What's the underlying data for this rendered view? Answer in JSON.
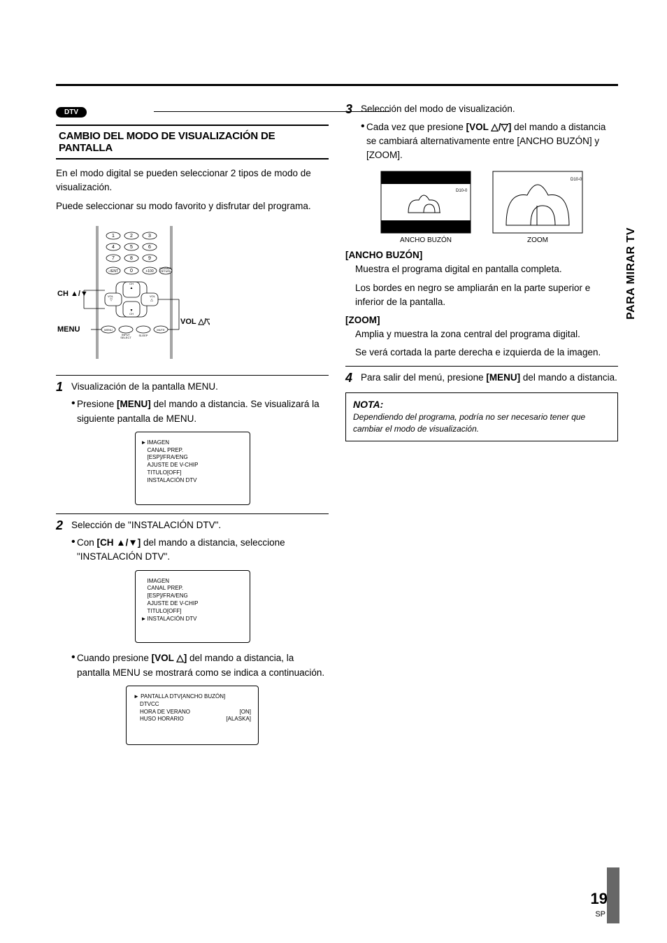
{
  "dtv_label": "DTV",
  "side_tab": "PARA MIRAR TV",
  "page_number": "19",
  "page_sp": "SP",
  "section_title": "CAMBIO DEL MODO DE VISUALIZACIÓN DE PANTALLA",
  "intro1": "En el modo digital se pueden seleccionar 2 tipos de modo de visualización.",
  "intro2": "Puede seleccionar su modo favorito y disfrutar del programa.",
  "remote_labels": {
    "ch": "CH ▲/▼",
    "menu": "MENU",
    "vol": "VOL △/▽"
  },
  "remote_btns": {
    "ent": "–/ENT",
    "plus100": "+100",
    "chret": "CHANNEL\nRETURN",
    "ch_up": "CH",
    "ch_dn": "CH",
    "vol_l": "VOL",
    "vol_r": "VOL",
    "menu": "MENU",
    "input": "INPUT\nSELECT",
    "sleep": "SLEEP",
    "mute": "MUTE"
  },
  "step1": {
    "title": "Visualización de la pantalla MENU.",
    "bullet_a": "Presione ",
    "bullet_a_bold": "[MENU]",
    "bullet_a2": " del mando a distancia. Se visualizará la siguiente pantalla de MENU."
  },
  "menu_items": [
    "IMAGEN",
    "CANAL PREP.",
    "[ESP]/FRA/ENG",
    "AJUSTE DE V-CHIP",
    "TITULO[OFF]",
    "INSTALACIÓN DTV"
  ],
  "step2": {
    "title_a": "Selección de \"INSTALACIÓN DTV\".",
    "bullet_pre": "Con ",
    "bullet_bold": "[CH ▲/▼]",
    "bullet_post": " del mando a distancia, seleccione \"INSTALACIÓN DTV\".",
    "bullet2_pre": "Cuando presione ",
    "bullet2_bold": "[VOL △]",
    "bullet2_post": " del mando a distancia, la pantalla MENU se mostrará como se indica a continuación."
  },
  "dtv_menu": [
    {
      "l": "PANTALLA DTV[ANCHO BUZÓN]",
      "r": ""
    },
    {
      "l": "DTVCC",
      "r": ""
    },
    {
      "l": "HORA DE VERANO",
      "r": "[ON]"
    },
    {
      "l": "HUSO HORARIO",
      "r": "[ALASKA]"
    }
  ],
  "step3": {
    "title": "Selección del modo de visualización.",
    "bullet_pre": "Cada vez que presione ",
    "bullet_bold": "[VOL △/▽]",
    "bullet_post": " del mando a distancia se cambiará alternativamente entre [ANCHO BUZÓN] y [ZOOM]."
  },
  "illus": {
    "label_a": "ANCHO BUZÓN",
    "label_b": "ZOOM",
    "badge": "D10-0"
  },
  "modes": {
    "ancho_title": "[ANCHO BUZÓN]",
    "ancho_p1": "Muestra el programa digital en pantalla completa.",
    "ancho_p2": "Los bordes en negro se ampliarán en la parte superior e inferior de la pantalla.",
    "zoom_title": "[ZOOM]",
    "zoom_p1": "Amplia y muestra la zona central del programa digital.",
    "zoom_p2": "Se verá cortada la parte derecha e izquierda de la imagen."
  },
  "step4": {
    "pre": "Para salir del menú, presione ",
    "bold": "[MENU]",
    "post": " del mando a distancia."
  },
  "note": {
    "title": "NOTA:",
    "body": "Dependiendo del programa, podría no ser necesario tener que cambiar el modo de visualización."
  }
}
